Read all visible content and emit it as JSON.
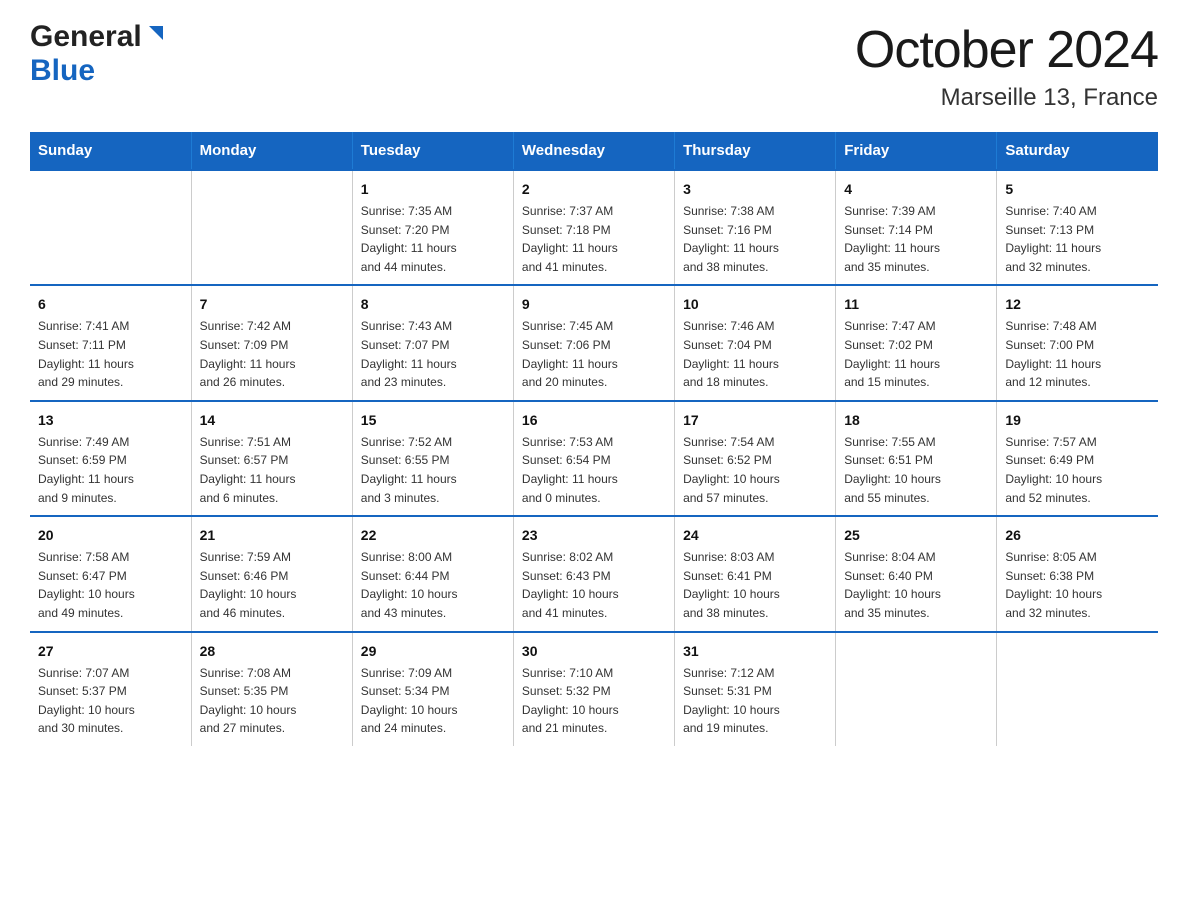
{
  "header": {
    "month_year": "October 2024",
    "location": "Marseille 13, France",
    "logo_general": "General",
    "logo_blue": "Blue"
  },
  "days_of_week": [
    "Sunday",
    "Monday",
    "Tuesday",
    "Wednesday",
    "Thursday",
    "Friday",
    "Saturday"
  ],
  "weeks": [
    [
      {
        "day": "",
        "info": ""
      },
      {
        "day": "",
        "info": ""
      },
      {
        "day": "1",
        "info": "Sunrise: 7:35 AM\nSunset: 7:20 PM\nDaylight: 11 hours\nand 44 minutes."
      },
      {
        "day": "2",
        "info": "Sunrise: 7:37 AM\nSunset: 7:18 PM\nDaylight: 11 hours\nand 41 minutes."
      },
      {
        "day": "3",
        "info": "Sunrise: 7:38 AM\nSunset: 7:16 PM\nDaylight: 11 hours\nand 38 minutes."
      },
      {
        "day": "4",
        "info": "Sunrise: 7:39 AM\nSunset: 7:14 PM\nDaylight: 11 hours\nand 35 minutes."
      },
      {
        "day": "5",
        "info": "Sunrise: 7:40 AM\nSunset: 7:13 PM\nDaylight: 11 hours\nand 32 minutes."
      }
    ],
    [
      {
        "day": "6",
        "info": "Sunrise: 7:41 AM\nSunset: 7:11 PM\nDaylight: 11 hours\nand 29 minutes."
      },
      {
        "day": "7",
        "info": "Sunrise: 7:42 AM\nSunset: 7:09 PM\nDaylight: 11 hours\nand 26 minutes."
      },
      {
        "day": "8",
        "info": "Sunrise: 7:43 AM\nSunset: 7:07 PM\nDaylight: 11 hours\nand 23 minutes."
      },
      {
        "day": "9",
        "info": "Sunrise: 7:45 AM\nSunset: 7:06 PM\nDaylight: 11 hours\nand 20 minutes."
      },
      {
        "day": "10",
        "info": "Sunrise: 7:46 AM\nSunset: 7:04 PM\nDaylight: 11 hours\nand 18 minutes."
      },
      {
        "day": "11",
        "info": "Sunrise: 7:47 AM\nSunset: 7:02 PM\nDaylight: 11 hours\nand 15 minutes."
      },
      {
        "day": "12",
        "info": "Sunrise: 7:48 AM\nSunset: 7:00 PM\nDaylight: 11 hours\nand 12 minutes."
      }
    ],
    [
      {
        "day": "13",
        "info": "Sunrise: 7:49 AM\nSunset: 6:59 PM\nDaylight: 11 hours\nand 9 minutes."
      },
      {
        "day": "14",
        "info": "Sunrise: 7:51 AM\nSunset: 6:57 PM\nDaylight: 11 hours\nand 6 minutes."
      },
      {
        "day": "15",
        "info": "Sunrise: 7:52 AM\nSunset: 6:55 PM\nDaylight: 11 hours\nand 3 minutes."
      },
      {
        "day": "16",
        "info": "Sunrise: 7:53 AM\nSunset: 6:54 PM\nDaylight: 11 hours\nand 0 minutes."
      },
      {
        "day": "17",
        "info": "Sunrise: 7:54 AM\nSunset: 6:52 PM\nDaylight: 10 hours\nand 57 minutes."
      },
      {
        "day": "18",
        "info": "Sunrise: 7:55 AM\nSunset: 6:51 PM\nDaylight: 10 hours\nand 55 minutes."
      },
      {
        "day": "19",
        "info": "Sunrise: 7:57 AM\nSunset: 6:49 PM\nDaylight: 10 hours\nand 52 minutes."
      }
    ],
    [
      {
        "day": "20",
        "info": "Sunrise: 7:58 AM\nSunset: 6:47 PM\nDaylight: 10 hours\nand 49 minutes."
      },
      {
        "day": "21",
        "info": "Sunrise: 7:59 AM\nSunset: 6:46 PM\nDaylight: 10 hours\nand 46 minutes."
      },
      {
        "day": "22",
        "info": "Sunrise: 8:00 AM\nSunset: 6:44 PM\nDaylight: 10 hours\nand 43 minutes."
      },
      {
        "day": "23",
        "info": "Sunrise: 8:02 AM\nSunset: 6:43 PM\nDaylight: 10 hours\nand 41 minutes."
      },
      {
        "day": "24",
        "info": "Sunrise: 8:03 AM\nSunset: 6:41 PM\nDaylight: 10 hours\nand 38 minutes."
      },
      {
        "day": "25",
        "info": "Sunrise: 8:04 AM\nSunset: 6:40 PM\nDaylight: 10 hours\nand 35 minutes."
      },
      {
        "day": "26",
        "info": "Sunrise: 8:05 AM\nSunset: 6:38 PM\nDaylight: 10 hours\nand 32 minutes."
      }
    ],
    [
      {
        "day": "27",
        "info": "Sunrise: 7:07 AM\nSunset: 5:37 PM\nDaylight: 10 hours\nand 30 minutes."
      },
      {
        "day": "28",
        "info": "Sunrise: 7:08 AM\nSunset: 5:35 PM\nDaylight: 10 hours\nand 27 minutes."
      },
      {
        "day": "29",
        "info": "Sunrise: 7:09 AM\nSunset: 5:34 PM\nDaylight: 10 hours\nand 24 minutes."
      },
      {
        "day": "30",
        "info": "Sunrise: 7:10 AM\nSunset: 5:32 PM\nDaylight: 10 hours\nand 21 minutes."
      },
      {
        "day": "31",
        "info": "Sunrise: 7:12 AM\nSunset: 5:31 PM\nDaylight: 10 hours\nand 19 minutes."
      },
      {
        "day": "",
        "info": ""
      },
      {
        "day": "",
        "info": ""
      }
    ]
  ]
}
